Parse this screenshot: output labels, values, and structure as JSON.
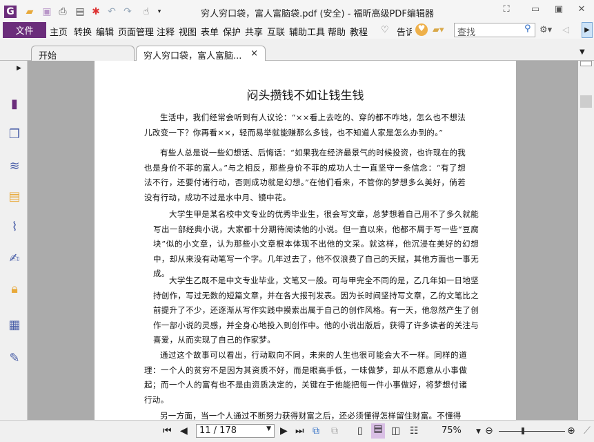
{
  "window": {
    "title": "穷人穷口袋，富人富脑袋.pdf (安全) - 福昕高级PDF编辑器"
  },
  "ribbon": {
    "file": "文件",
    "menus": [
      "主页",
      "转换",
      "编辑",
      "页面管理",
      "注释",
      "视图",
      "表单",
      "保护",
      "共享",
      "互联",
      "辅助工具",
      "帮助",
      "教程"
    ],
    "tell": "告诉",
    "search_placeholder": "查找"
  },
  "tabs": [
    {
      "label": "开始"
    },
    {
      "label": "穷人穷口袋，富人富脑...",
      "close": "×"
    }
  ],
  "document": {
    "title": "闷头攒钱不如让钱生钱",
    "paragraphs": [
      "生活中，我们经常会听到有人议论：“××看上去吃的、穿的都不咋地，怎么也不想法儿改变一下？你再看××，轻而易举就能赚那么多钱，也不知道人家是怎么办到的。”",
      "有些人总是说一些幻想话、后悔话：“如果我在经济最景气的时候投资，也许现在的我也是身价不菲的富人。”与之相反，那些身价不菲的成功人士一直坚守一条信念：“有了想法不行，还要付诸行动，否则成功就是幻想。”在他们看来，不管你的梦想多么美好，倘若没有行动，成功不过是水中月、镜中花。",
      "大学生甲是某名校中文专业的优秀毕业生，很会写文章，总梦想着自己用不了多久就能写出一部经典小说，大家都十分期待阅读他的小说。但一直以来，他都不屑于写一些“豆腐块”似的小文章，认为那些小文章根本体现不出他的文采。就这样，他沉浸在美好的幻想中，却从来没有动笔写一个字。几年过去了，他不仅浪费了自己的天赋，其他方面也一事无成。",
      "大学生乙既不是中文专业毕业，文笔又一般。可与甲完全不同的是，乙几年如一日地坚持创作，写过无数的短篇文章，并在各大报刊发表。因为长时间坚持写文章，乙的文笔比之前提升了不少，还逐渐从写作实践中摸索出属于自己的创作风格。有一天，他忽然产生了创作一部小说的灵感，并全身心地投入到创作中。他的小说出版后，获得了许多读者的关注与喜爱，从而实现了自己的作家梦。",
      "通过这个故事可以看出，行动取向不同，未来的人生也很可能会大不一样。同样的道理：一个人的贫穷不是因为其资质不好，而是眼高手低，一味做梦，却从不愿意从小事做起；而一个人的富有也不是由资质决定的，关键在于他能把每一件小事做好，将梦想付诸行动。",
      "另一方面，当一个人通过不断努力获得财富之后，还必须懂得怎样留住财富。不懂得"
    ]
  },
  "statusbar": {
    "page": "11 / 178",
    "zoom": "75%",
    "zoom_level_percent": 75
  },
  "colors": {
    "accent": "#6b2d7b"
  }
}
